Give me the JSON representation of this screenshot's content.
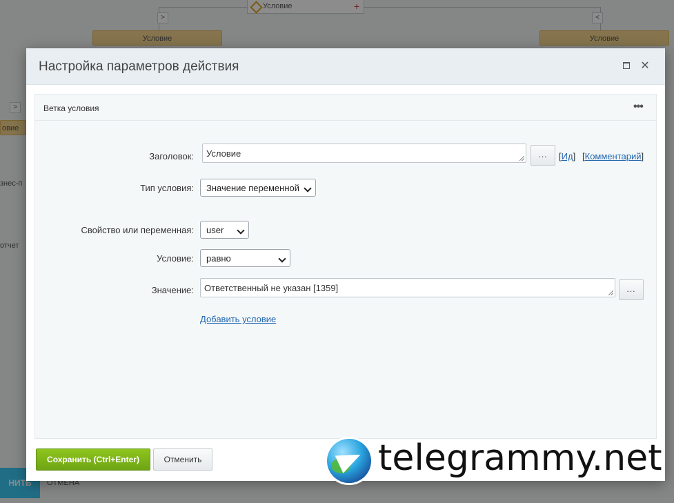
{
  "background": {
    "top_node_label": "Условие",
    "left_node_label": "Условие",
    "right_node_label": "Условие",
    "side_labels": [
      "овие",
      "знес-п",
      "отчет"
    ],
    "bottom_button": "НИТЬ",
    "bottom_link": "ОТМЕНА"
  },
  "dialog": {
    "title": "Настройка параметров действия",
    "panel_title": "Ветка условия",
    "fields": {
      "title_label": "Заголовок:",
      "title_value": "Условие",
      "dots": "...",
      "id_link": "Ид",
      "comment_link": "Комментарий",
      "condition_type_label": "Тип условия:",
      "condition_type_value": "Значение переменной",
      "property_label": "Свойство или переменная:",
      "property_value": "user",
      "condition_label": "Условие:",
      "condition_value": "равно",
      "value_label": "Значение:",
      "value_value": "Ответственный не указан [1359]",
      "add_condition": "Добавить условие"
    },
    "buttons": {
      "save": "Сохранить (Ctrl+Enter)",
      "cancel": "Отменить"
    }
  },
  "watermark": {
    "text": "telegrammy.net"
  }
}
